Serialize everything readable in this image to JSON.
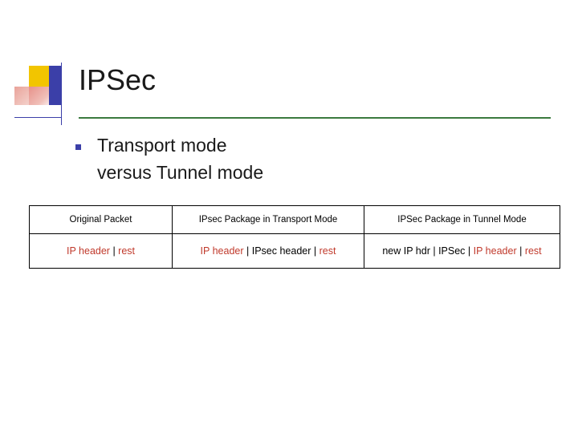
{
  "slide": {
    "title": "IPSec",
    "bullet": {
      "marker": "square-bullet",
      "line1": "Transport mode",
      "line2": "versus Tunnel mode"
    },
    "table": {
      "headers": [
        "Original Packet",
        "IPsec Package in Transport Mode",
        "IPSec Package in Tunnel Mode"
      ],
      "row": {
        "cell1": {
          "part1": "IP header",
          "sep1": " | ",
          "part2": "rest"
        },
        "cell2": {
          "part1": "IP header",
          "sep1": " | ",
          "part2": "IPsec header",
          "sep2": " | ",
          "part3": "rest"
        },
        "cell3": {
          "part1": "new IP hdr",
          "sep1": " | ",
          "part2": "IPSec",
          "sep2": " | ",
          "part3": "IP header",
          "sep3": " | ",
          "part4": "rest"
        }
      }
    },
    "colors": {
      "accent_blue": "#3b3fa8",
      "accent_yellow": "#f2c500",
      "accent_red": "#e7918a",
      "rule_green": "#3b7a3f",
      "text_red": "#c0392b"
    }
  }
}
